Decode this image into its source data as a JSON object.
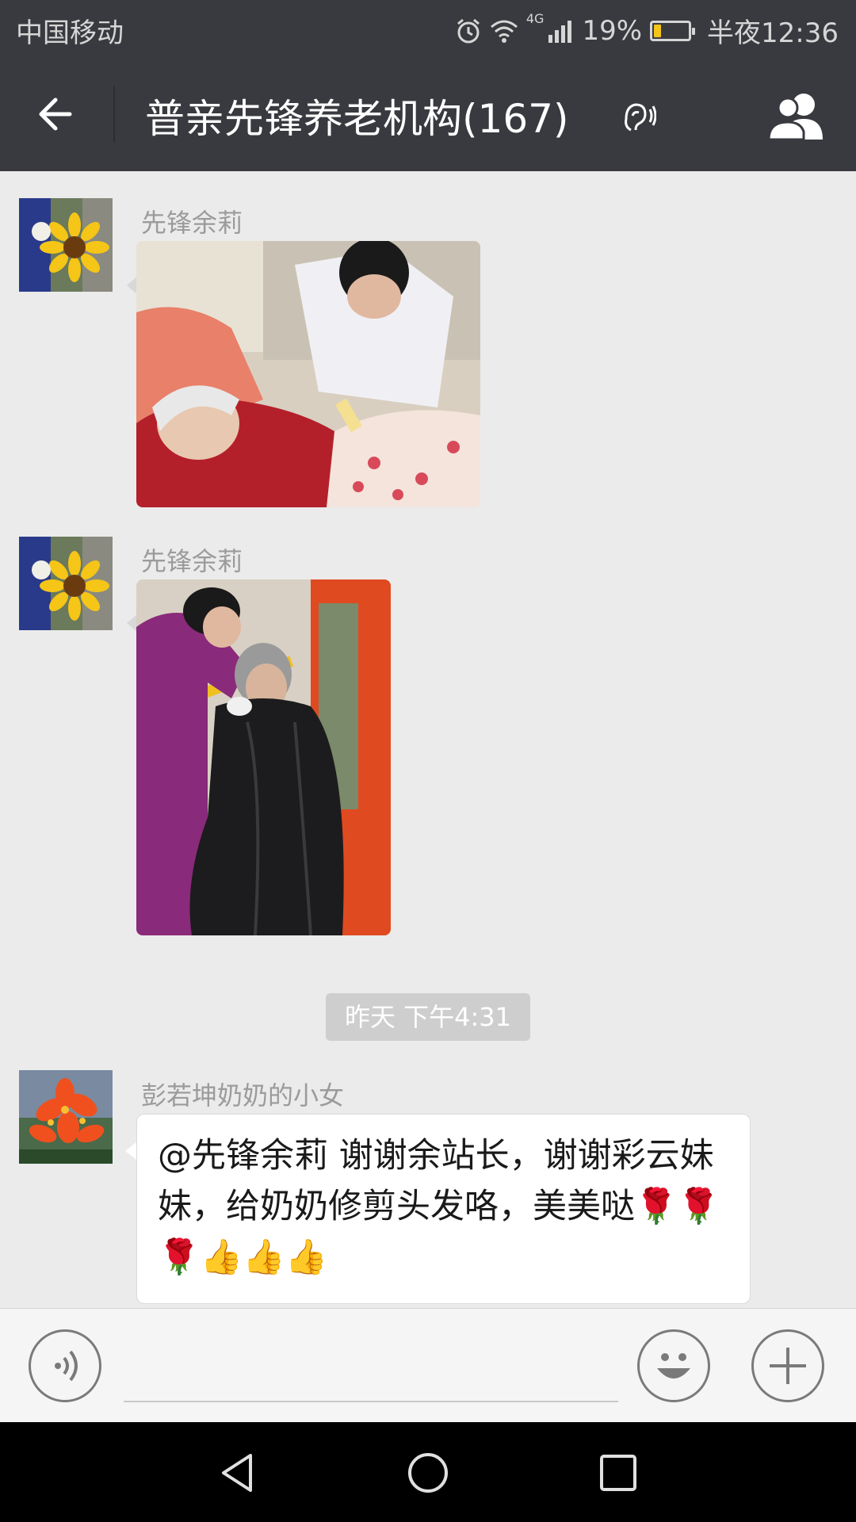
{
  "status_bar": {
    "carrier": "中国移动",
    "network": "4G",
    "battery": "19%",
    "battery_level": 0.19,
    "time": "半夜12:36"
  },
  "header": {
    "title": "普亲先锋养老机构(167)"
  },
  "messages": [
    {
      "sender": "先锋余莉",
      "type": "image"
    },
    {
      "sender": "先锋余莉",
      "type": "image"
    },
    {
      "timestamp": "昨天 下午4:31"
    },
    {
      "sender": "彭若坤奶奶的小女",
      "type": "text",
      "text": "@先锋余莉 谢谢余站长，谢谢彩云妹妹，给奶奶修剪头发咯，美美哒🌹🌹🌹👍👍👍"
    }
  ],
  "colors": {
    "header_bg": "#393a3f",
    "chat_bg": "#ebebeb",
    "timestamp_bg": "#cecece"
  }
}
